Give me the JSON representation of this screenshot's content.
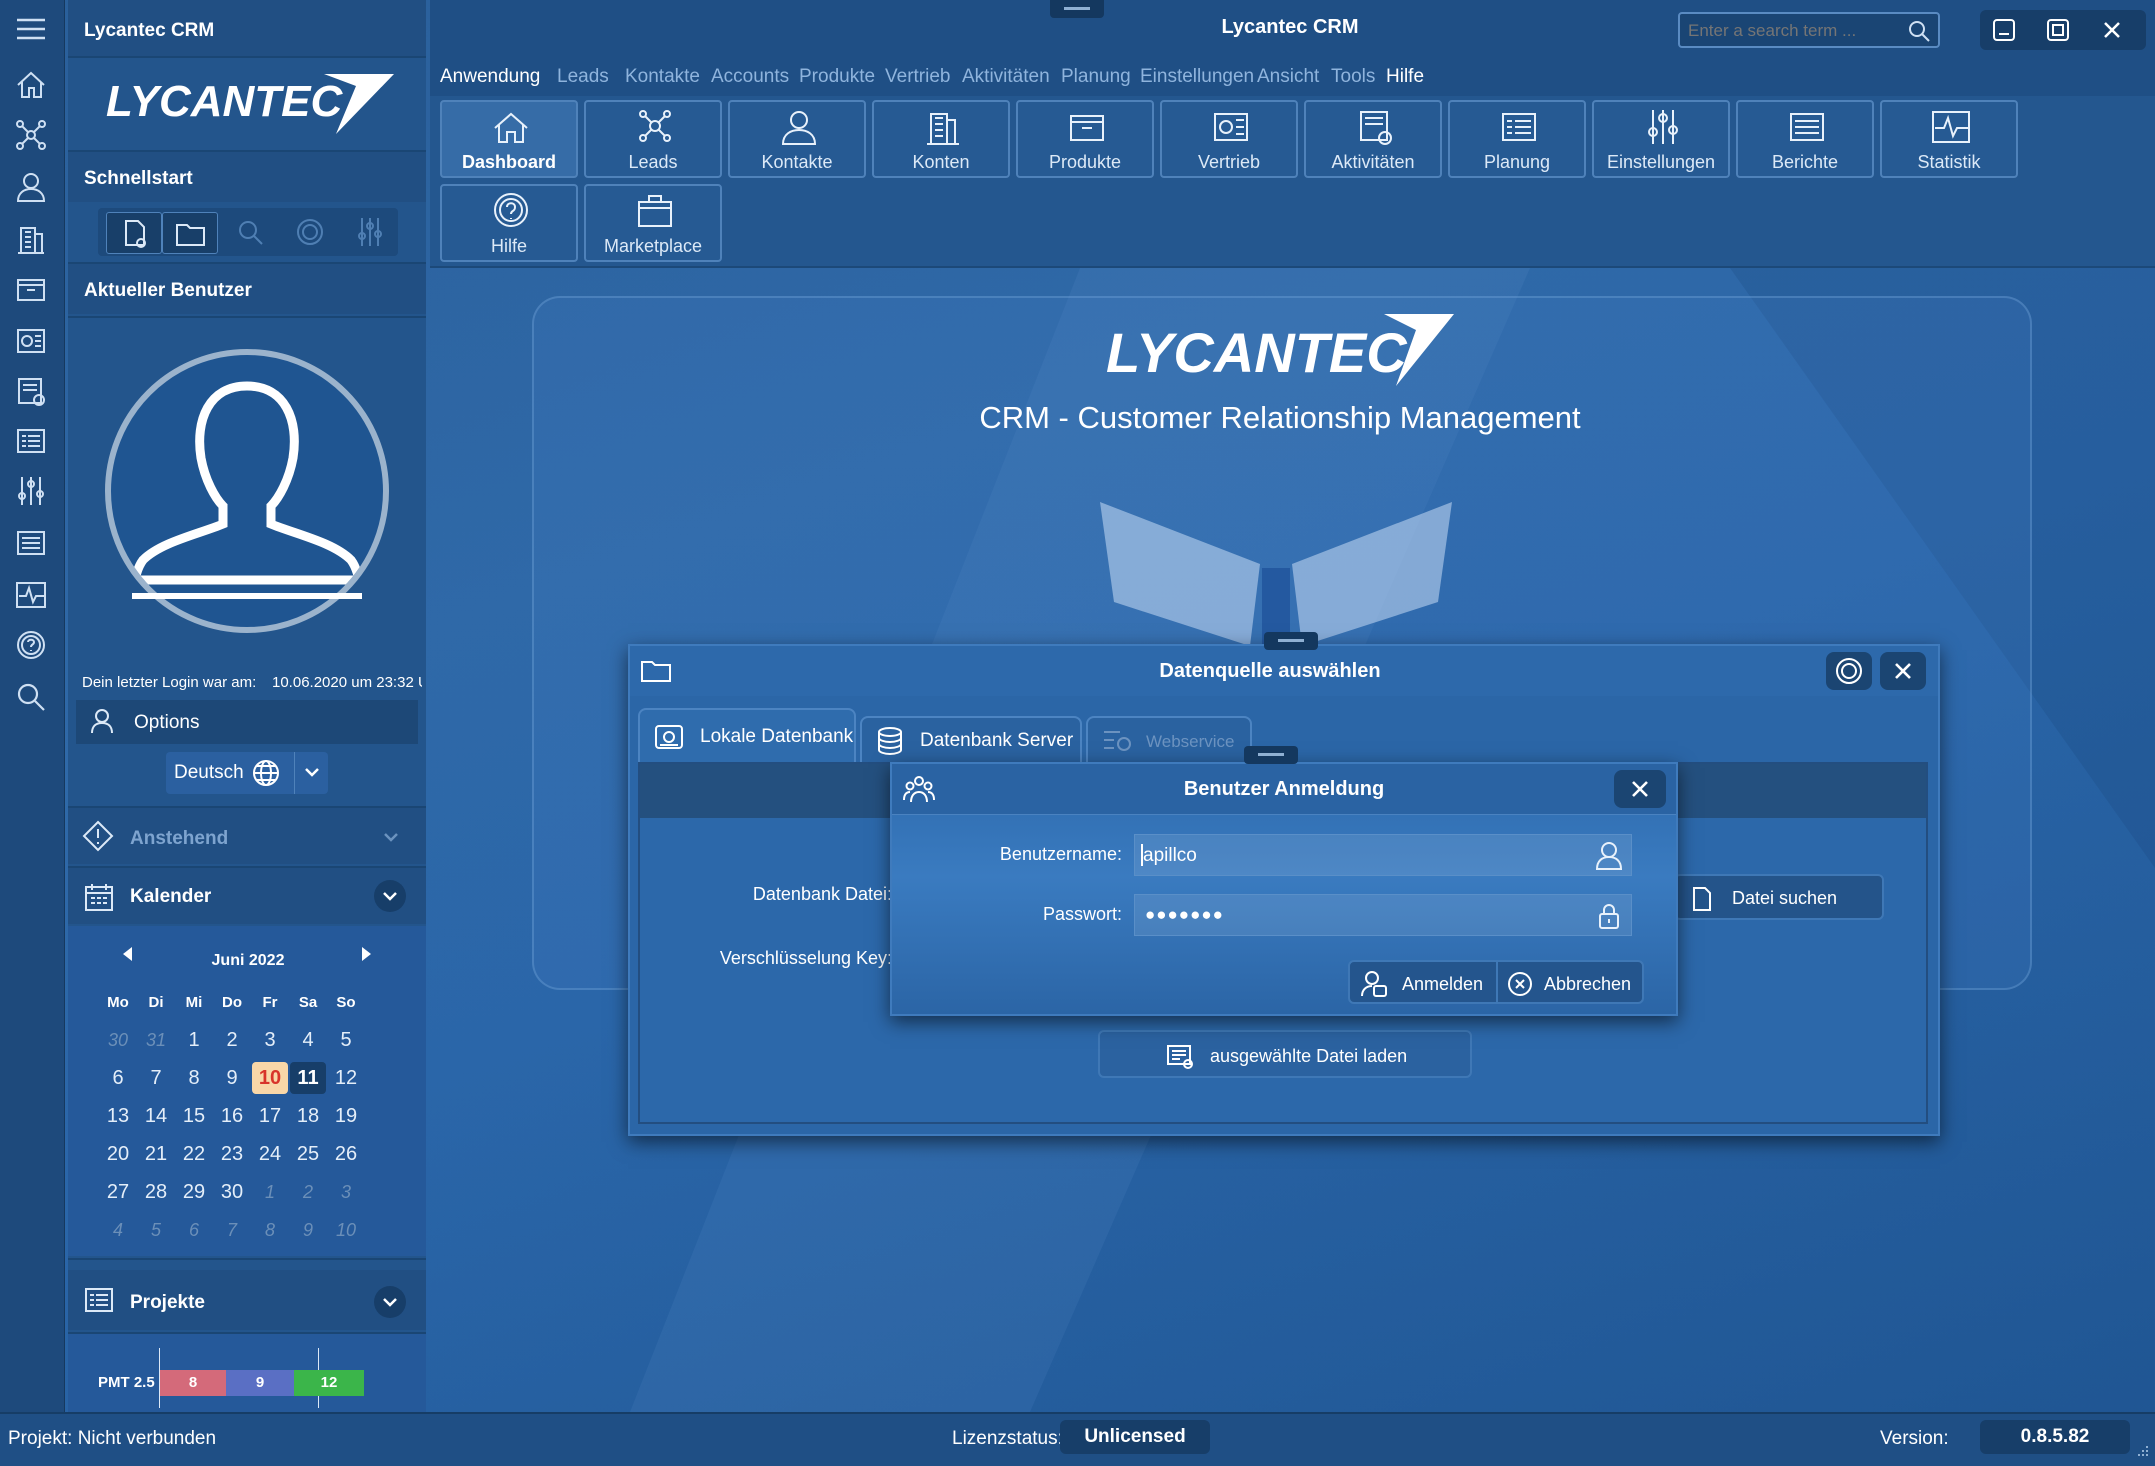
{
  "app": {
    "window_title": "Lycantec CRM",
    "sidebar_title": "Lycantec CRM",
    "logo_text": "LYCANTEC"
  },
  "search": {
    "placeholder": "Enter a search term ..."
  },
  "menu": [
    "Anwendung",
    "Leads",
    "Kontakte",
    "Accounts",
    "Produkte",
    "Vertrieb",
    "Aktivitäten",
    "Planung",
    "Einstellungen",
    "Ansicht",
    "Tools",
    "Hilfe"
  ],
  "ribbon": [
    "Dashboard",
    "Leads",
    "Kontakte",
    "Konten",
    "Produkte",
    "Vertrieb",
    "Aktivitäten",
    "Planung",
    "Einstellungen",
    "Berichte",
    "Statistik",
    "Hilfe",
    "Marketplace"
  ],
  "sidebar": {
    "quickstart": "Schnellstart",
    "current_user": "Aktueller Benutzer",
    "last_login_label": "Dein letzter Login war am:",
    "last_login_value": "10.06.2020 um 23:32 U",
    "options": "Options",
    "language": "Deutsch",
    "pending": "Anstehend",
    "calendar": "Kalender",
    "projects": "Projekte"
  },
  "calendar": {
    "month": "Juni 2022",
    "weekdays": [
      "Mo",
      "Di",
      "Mi",
      "Do",
      "Fr",
      "Sa",
      "So"
    ],
    "weeks": [
      [
        "30",
        "31",
        "1",
        "2",
        "3",
        "4",
        "5"
      ],
      [
        "6",
        "7",
        "8",
        "9",
        "10",
        "11",
        "12"
      ],
      [
        "13",
        "14",
        "15",
        "16",
        "17",
        "18",
        "19"
      ],
      [
        "20",
        "21",
        "22",
        "23",
        "24",
        "25",
        "26"
      ],
      [
        "27",
        "28",
        "29",
        "30",
        "1",
        "2",
        "3"
      ],
      [
        "4",
        "5",
        "6",
        "7",
        "8",
        "9",
        "10"
      ]
    ],
    "today": "10",
    "selected": "11"
  },
  "project": {
    "name": "PMT 2.5",
    "segments": [
      {
        "value": "8",
        "color": "#d46a7a"
      },
      {
        "value": "9",
        "color": "#5a6fc4"
      },
      {
        "value": "12",
        "color": "#3bb54a"
      }
    ]
  },
  "main": {
    "logo_text": "LYCANTEC",
    "subtitle": "CRM - Customer Relationship Management"
  },
  "datasource": {
    "title": "Datenquelle auswählen",
    "tabs": [
      "Lokale Datenbank",
      "Datenbank Server",
      "Webservice"
    ],
    "db_file_label": "Datenbank Datei:",
    "key_label": "Verschlüsselung Key:",
    "browse_button": "Datei suchen",
    "load_button": "ausgewählte Datei laden"
  },
  "login": {
    "title": "Benutzer Anmeldung",
    "username_label": "Benutzername:",
    "username_value": "apillco",
    "password_label": "Passwort:",
    "password_value": "●●●●●●●",
    "login_button": "Anmelden",
    "cancel_button": "Abbrechen"
  },
  "status": {
    "project_text": "Projekt: Nicht verbunden",
    "license_label": "Lizenzstatus:",
    "license_value": "Unlicensed",
    "version_label": "Version:",
    "version_value": "0.8.5.82"
  }
}
